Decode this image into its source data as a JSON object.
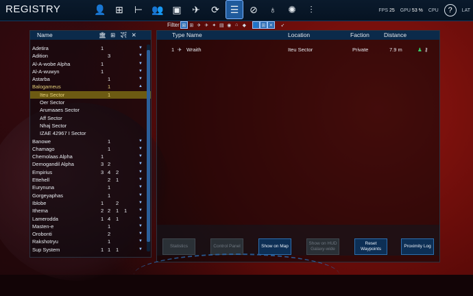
{
  "window": {
    "title": "REGISTRY"
  },
  "nav": {
    "tabs": [
      {
        "icon": "person-icon",
        "glyph": "👤"
      },
      {
        "icon": "org-chart-icon",
        "glyph": "⊞"
      },
      {
        "icon": "hierarchy-icon",
        "glyph": "⊢"
      },
      {
        "icon": "group-icon",
        "glyph": "👥"
      },
      {
        "icon": "window-icon",
        "glyph": "▣"
      },
      {
        "icon": "ship-icon",
        "glyph": "✈"
      },
      {
        "icon": "cycle-icon",
        "glyph": "⟳"
      },
      {
        "icon": "registry-icon",
        "glyph": "☰",
        "active": true
      },
      {
        "icon": "compass-icon",
        "glyph": "⊘"
      },
      {
        "icon": "planet-icon",
        "glyph": "♁"
      },
      {
        "icon": "galaxy-icon",
        "glyph": "✺"
      },
      {
        "icon": "settings-sliders-icon",
        "glyph": "⫶"
      }
    ]
  },
  "stats": {
    "fps_label": "FPS",
    "fps_value": "25",
    "gpu_label": "GPU",
    "gpu_value": "53 %",
    "cpu_label": "CPU",
    "lat_label": "LAT"
  },
  "filter": {
    "label": "Filter"
  },
  "left_header": {
    "name": "Name",
    "icons": "🏛 ⊞ ✈ ✕"
  },
  "sectors": [
    {
      "name": "Adetira",
      "v": [
        "1",
        "",
        "",
        ""
      ],
      "arrow": "▼"
    },
    {
      "name": "Adition",
      "v": [
        "",
        "3",
        "",
        ""
      ],
      "arrow": "▼"
    },
    {
      "name": "Al-A-wobe Alpha",
      "v": [
        "1",
        "",
        "",
        ""
      ],
      "arrow": "▼"
    },
    {
      "name": "Al-A-wuwyn",
      "v": [
        "1",
        "",
        "",
        ""
      ],
      "arrow": "▼"
    },
    {
      "name": "Astarba",
      "v": [
        "",
        "1",
        "",
        ""
      ],
      "arrow": "▼"
    },
    {
      "name": "Balogameus",
      "v": [
        "",
        "1",
        "",
        ""
      ],
      "arrow": "▲",
      "hl": true
    },
    {
      "name": "Iteu Sector",
      "v": [
        "",
        "1",
        "",
        ""
      ],
      "arrow": "",
      "sub": true,
      "selected": true,
      "hl": true
    },
    {
      "name": "Oer Sector",
      "v": [
        "",
        "",
        "",
        ""
      ],
      "arrow": "",
      "sub": true
    },
    {
      "name": "Arumaaes Sector",
      "v": [
        "",
        "",
        "",
        ""
      ],
      "arrow": "",
      "sub": true
    },
    {
      "name": "Aff Sector",
      "v": [
        "",
        "",
        "",
        ""
      ],
      "arrow": "",
      "sub": true
    },
    {
      "name": "Nhaj Sector",
      "v": [
        "",
        "",
        "",
        ""
      ],
      "arrow": "",
      "sub": true
    },
    {
      "name": "IZAE 42967 I Sector",
      "v": [
        "",
        "",
        "",
        ""
      ],
      "arrow": "",
      "sub": true
    },
    {
      "name": "Banowe",
      "v": [
        "",
        "1",
        "",
        ""
      ],
      "arrow": "▼"
    },
    {
      "name": "Chamago",
      "v": [
        "",
        "1",
        "",
        ""
      ],
      "arrow": "▼"
    },
    {
      "name": "Chemolaas Alpha",
      "v": [
        "1",
        "",
        "",
        ""
      ],
      "arrow": "▼"
    },
    {
      "name": "Demogandil Alpha",
      "v": [
        "3",
        "2",
        "",
        ""
      ],
      "arrow": "▼"
    },
    {
      "name": "Empirius",
      "v": [
        "3",
        "4",
        "2",
        ""
      ],
      "arrow": "▼"
    },
    {
      "name": "Ettehell",
      "v": [
        "",
        "2",
        "1",
        ""
      ],
      "arrow": "▼"
    },
    {
      "name": "Eurynuna",
      "v": [
        "",
        "1",
        "",
        ""
      ],
      "arrow": "▼"
    },
    {
      "name": "Gorgeyaphas",
      "v": [
        "",
        "1",
        "",
        ""
      ],
      "arrow": "▼"
    },
    {
      "name": "Iblobe",
      "v": [
        "1",
        "",
        "2",
        ""
      ],
      "arrow": "▼"
    },
    {
      "name": "Ithema",
      "v": [
        "2",
        "2",
        "1",
        "1"
      ],
      "arrow": "▼"
    },
    {
      "name": "Lamerodda",
      "v": [
        "1",
        "4",
        "1",
        ""
      ],
      "arrow": "▼"
    },
    {
      "name": "Masten-e",
      "v": [
        "",
        "1",
        "",
        ""
      ],
      "arrow": "▼"
    },
    {
      "name": "Orobonti",
      "v": [
        "",
        "2",
        "",
        ""
      ],
      "arrow": "▼"
    },
    {
      "name": "Rakshotryu",
      "v": [
        "",
        "1",
        "",
        ""
      ],
      "arrow": "▼"
    },
    {
      "name": "Sup System",
      "v": [
        "1",
        "1",
        "1",
        ""
      ],
      "arrow": "▼"
    }
  ],
  "right_header": {
    "type": "Type",
    "name": "Name",
    "location": "Location",
    "faction": "Faction",
    "distance": "Distance"
  },
  "entries": [
    {
      "index": "1",
      "name": "Wraith",
      "location": "Iteu Sector",
      "faction": "Private",
      "distance": "7.9 m"
    }
  ],
  "actions": [
    {
      "label": "Statistics",
      "disabled": true
    },
    {
      "label": "Control Panel",
      "disabled": true
    },
    {
      "label": "Show on Map",
      "disabled": false
    },
    {
      "label": "Show on HUD Galaxy-wide",
      "disabled": true
    },
    {
      "label": "Reset Waypoints",
      "disabled": false
    },
    {
      "label": "Proximity Log",
      "disabled": false
    }
  ],
  "help": {
    "label": "?"
  }
}
